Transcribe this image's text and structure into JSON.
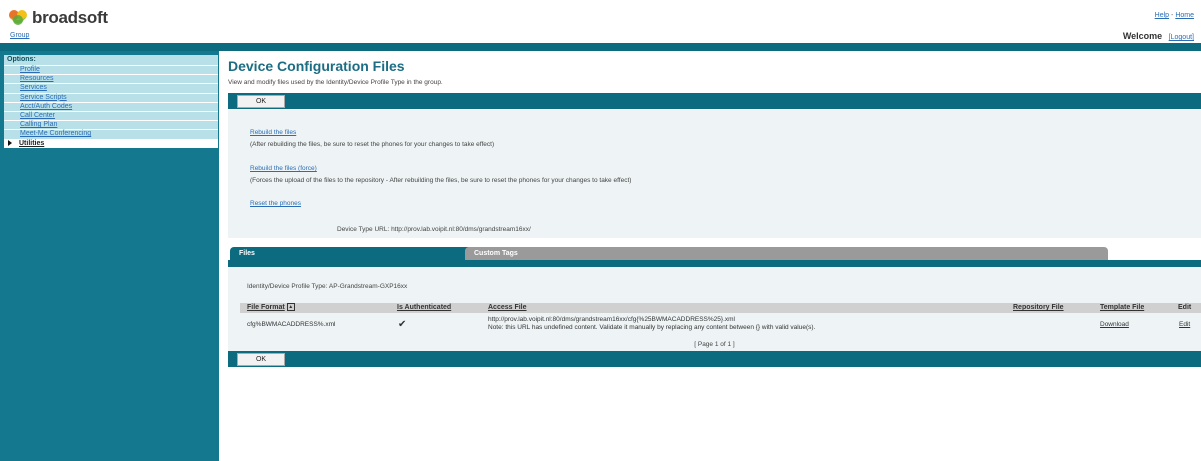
{
  "header": {
    "brand": "broadsoft",
    "help_label": "Help",
    "separator": "-",
    "home_label": "Home",
    "group_label": "Group",
    "welcome_label": "Welcome",
    "logout_label": "[Logout]"
  },
  "sidebar": {
    "options_label": "Options:",
    "items": [
      {
        "label": "Profile"
      },
      {
        "label": "Resources"
      },
      {
        "label": "Services"
      },
      {
        "label": "Service Scripts"
      },
      {
        "label": "Acct/Auth Codes"
      },
      {
        "label": "Call Center"
      },
      {
        "label": "Calling Plan"
      },
      {
        "label": "Meet-Me Conferencing"
      },
      {
        "label": "Utilities"
      }
    ],
    "selected": "Utilities"
  },
  "main": {
    "title": "Device Configuration Files",
    "subtitle": "View and modify files used by the Identity/Device Profile Type in the group.",
    "ok_label": "OK",
    "ok_label_bottom": "OK",
    "rebuild_link": "Rebuild the files",
    "rebuild_note": "(After rebuilding the files, be sure to reset the phones for your changes to take effect)",
    "rebuild_force_link": "Rebuild the files (force)",
    "rebuild_force_note": "(Forces the upload of the files to the repository - After rebuilding the files, be sure to reset the phones for your changes to take effect)",
    "reset_link": "Reset the phones",
    "device_type_url": "Device Type URL: http://prov.lab.voipit.nl:80/dms/grandstream16xx/"
  },
  "tabs": [
    {
      "label": "Files",
      "active": true
    },
    {
      "label": "Custom Tags",
      "active": false
    }
  ],
  "files": {
    "profile_type": "Identity/Device Profile Type: AP-Grandstream-GXP16xx",
    "columns": [
      "File Format",
      "Is Authenticated",
      "Access File",
      "Repository File",
      "Template File",
      "Edit"
    ],
    "rows": [
      {
        "file_format": "cfg%BWMACADDRESS%.xml",
        "is_authenticated": "✔",
        "access_file_url": "http://prov.lab.voipit.nl:80/dms/grandstream16xx/cfg{%25BWMACADDRESS%25}.xml",
        "access_file_note": "Note: this URL has undefined content. Validate it manually by replacing any content between {} with valid value(s).",
        "repository_file": "",
        "template_file": "Download",
        "edit": "Edit"
      }
    ],
    "pager": "[ Page 1 of 1 ]"
  },
  "colors": {
    "teal_dark": "#0d6b80",
    "teal_sidebar": "#14788e",
    "nav_item_bg": "#b7e0e8",
    "title_color": "#1c6d83",
    "link_color": "#2a6db5"
  }
}
